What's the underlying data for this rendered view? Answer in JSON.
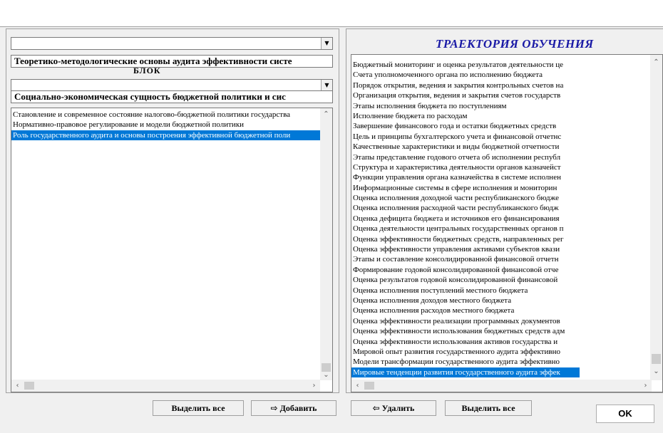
{
  "left": {
    "combo1_value": "",
    "heading1": "Теоретико-методологические основы аудита эффективности систе",
    "block_label": "БЛОК",
    "combo2_value": "",
    "heading2": "Социально-экономическая сущность бюджетной политики и сис",
    "items": [
      "Становление и современное состояние налогово-бюджетной политики государства",
      "Нормативно-правовое регулирование и модели бюджетной политики",
      "Роль государственного аудита и основы построения эффективной бюджетной поли"
    ],
    "selected_index": 2
  },
  "right": {
    "title": "ТРАЕКТОРИЯ ОБУЧЕНИЯ",
    "items": [
      "Бюджетный мониторинг и оценка результатов деятельности це",
      "Счета уполномоченного органа по исполнению бюджета",
      "Порядок открытия, ведения и закрытия контрольных счетов на",
      "Организация открытия, ведения и закрытия счетов государств",
      "Этапы исполнения бюджета по поступлениям",
      "Исполнение бюджета по расходам",
      "Завершение финансового года и остатки бюджетных средств",
      "Цель и принципы бухгалтерского учета и финансовой отчетнс",
      "Качественные характеристики и виды бюджетной отчетности",
      "Этапы представление годового отчета об исполнении республ",
      "Структура и характеристика деятельности органов казначейст",
      "Функции управления органа казначейства в системе исполнен",
      "Информационные системы в сфере исполнения и мониторин",
      "Оценка исполнения доходной части республиканского бюдже",
      "Оценка исполнения расходной части республиканского бюдж",
      "Оценка дефицита бюджета и источников его финансирования",
      "Оценка деятельности центральных государственных органов п",
      "Оценка эффективности бюджетных средств, направленных рег",
      "Оценка эффективности управления активами субъектов квази",
      "Этапы и составление консолидированной финансовой отчетн",
      "Формирование годовой консолидированной финансовой отче",
      "Оценка результатов годовой консолидированной финансовой",
      "Оценка исполнения поступлений местного бюджета",
      "Оценка исполнения доходов местного бюджета",
      "Оценка исполнения расходов местного бюджета",
      "Оценка эффективности реализации программных документов",
      "Оценка эффективности использования бюджетных средств адм",
      "Оценка эффективности использования активов государства и",
      "Мировой опыт развития государственного аудита эффективно",
      "Модели трансформации государственного аудита эффективно",
      "Мировые тенденции развития государственного аудита эффек"
    ],
    "selected_index": 30
  },
  "buttons": {
    "select_all_left": "Выделить все",
    "add": "Добавить",
    "delete": "Удалить",
    "select_all_right": "Выделить все",
    "ok": "OK"
  },
  "icons": {
    "add": "arrow-right-icon",
    "delete": "arrow-left-icon"
  },
  "colors": {
    "title": "#1a1aa6",
    "selection": "#0078d7"
  }
}
